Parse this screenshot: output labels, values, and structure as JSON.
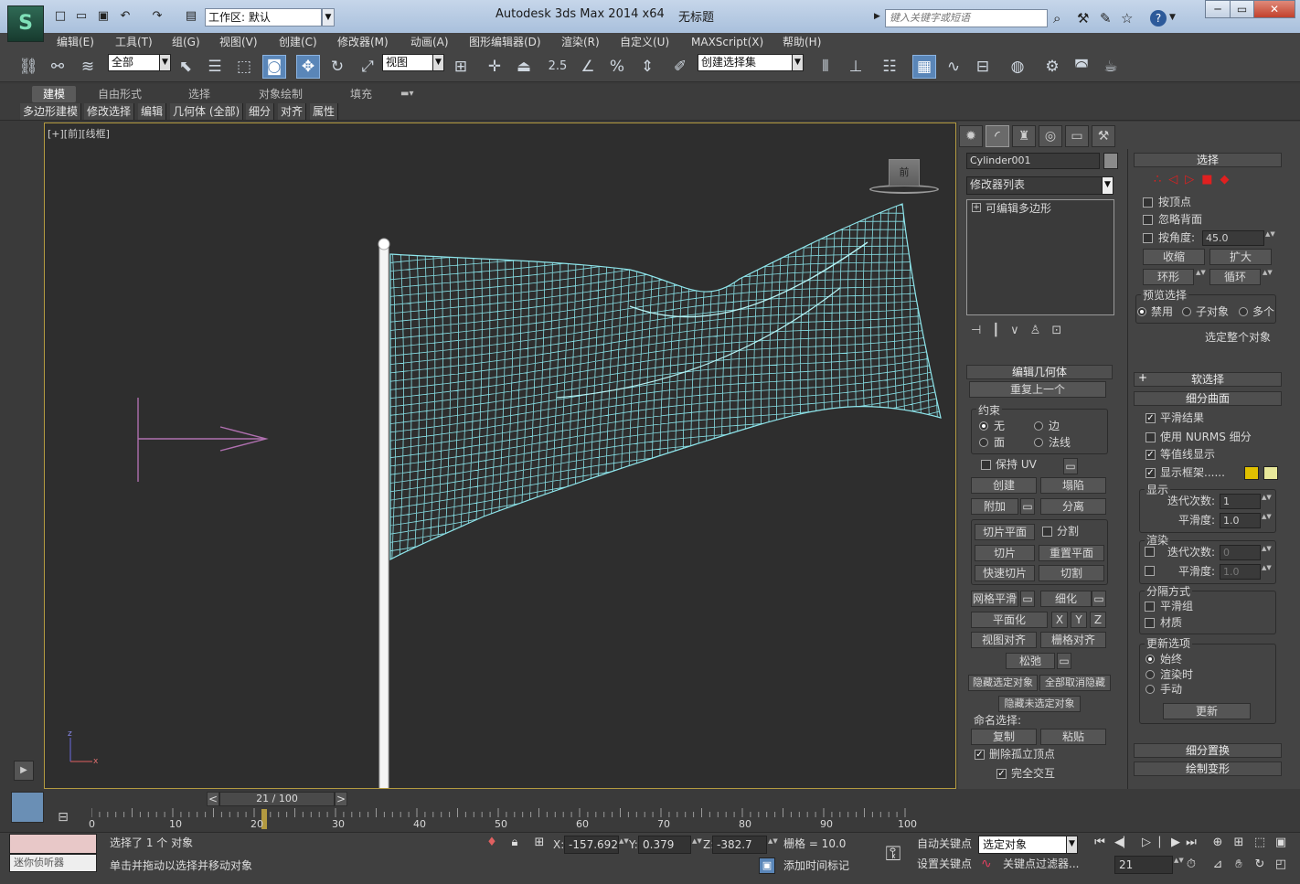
{
  "window": {
    "app_title": "Autodesk 3ds Max  2014 x64",
    "doc_title": "无标题",
    "workspace": "工作区: 默认",
    "search_placeholder": "键入关键字或短语",
    "min": "─",
    "max": "▭",
    "close": "✕",
    "help": "?"
  },
  "menu": [
    "编辑(E)",
    "工具(T)",
    "组(G)",
    "视图(V)",
    "创建(C)",
    "修改器(M)",
    "动画(A)",
    "图形编辑器(D)",
    "渲染(R)",
    "自定义(U)",
    "MAXScript(X)",
    "帮助(H)"
  ],
  "toolbar": {
    "filter": "全部",
    "ref_coord": "视图",
    "snap_angle": "2.5",
    "named_sel": "创建选择集"
  },
  "ribbon": {
    "tabs": [
      "建模",
      "自由形式",
      "选择",
      "对象绘制",
      "填充"
    ],
    "subtabs": [
      "多边形建模",
      "修改选择",
      "编辑",
      "几何体 (全部)",
      "细分",
      "对齐",
      "属性"
    ]
  },
  "viewport": {
    "label": "[+][前][线框]",
    "navcube": "前"
  },
  "cmd": {
    "object_name": "Cylinder001",
    "modifier_list": "修改器列表",
    "stack_item": "可编辑多边形",
    "edit_geometry": {
      "title": "编辑几何体",
      "repeat": "重复上一个",
      "constraints": "约束",
      "c_none": "无",
      "c_edge": "边",
      "c_face": "面",
      "c_normal": "法线",
      "preserve_uv": "保持 UV",
      "create": "创建",
      "collapse": "塌陷",
      "attach": "附加",
      "detach": "分离",
      "slice_plane": "切片平面",
      "split": "分割",
      "slice": "切片",
      "reset_plane": "重置平面",
      "quickslice": "快速切片",
      "cut": "切割",
      "meshsmooth": "网格平滑",
      "tessellate": "细化",
      "make_planar": "平面化",
      "x": "X",
      "y": "Y",
      "z": "Z",
      "view_align": "视图对齐",
      "grid_align": "栅格对齐",
      "relax": "松弛",
      "hide_sel": "隐藏选定对象",
      "unhide_all": "全部取消隐藏",
      "hide_unsel": "隐藏未选定对象",
      "named_sel": "命名选择:",
      "copy": "复制",
      "paste": "粘贴",
      "delete_iso": "删除孤立顶点",
      "full_interact": "完全交互"
    },
    "selection": {
      "title": "选择",
      "by_vertex": "按顶点",
      "ignore_back": "忽略背面",
      "by_angle": "按角度:",
      "angle": "45.0",
      "shrink": "收缩",
      "grow": "扩大",
      "ring": "环形",
      "loop": "循环",
      "preview": "预览选择",
      "p_off": "禁用",
      "p_sub": "子对象",
      "p_multi": "多个",
      "whole": "选定整个对象"
    },
    "soft_sel": "软选择",
    "subdiv": {
      "title": "细分曲面",
      "smooth_result": "平滑结果",
      "nurms": "使用 NURMS 细分",
      "isoline": "等值线显示",
      "show_cage": "显示框架......",
      "display": "显示",
      "iter": "迭代次数:",
      "iter_val": "1",
      "smooth": "平滑度:",
      "smooth_val": "1.0",
      "render": "渲染",
      "r_iter_val": "0",
      "r_smooth_val": "1.0",
      "sep_by": "分隔方式",
      "smooth_groups": "平滑组",
      "materials": "材质",
      "update_opts": "更新选项",
      "always": "始终",
      "when_render": "渲染时",
      "manual": "手动",
      "update": "更新"
    },
    "subdiv_disp": "细分置换",
    "paint_deform": "绘制变形"
  },
  "time": {
    "frame": "21 / 100",
    "ticks": [
      "0",
      "10",
      "20",
      "30",
      "40",
      "50",
      "60",
      "70",
      "80",
      "90",
      "100"
    ]
  },
  "status": {
    "listener": "迷你侦听器",
    "selected": "选择了 1 个 对象",
    "prompt": "单击并拖动以选择并移动对象",
    "x": "-157.692",
    "y": "0.379",
    "z": "-382.7",
    "grid": "栅格 = 10.0",
    "add_tag": "添加时间标记",
    "autokey": "自动关键点",
    "setkey": "设置关键点",
    "sel_obj": "选定对象",
    "key_filters": "关键点过滤器...",
    "cur_frame": "21"
  }
}
